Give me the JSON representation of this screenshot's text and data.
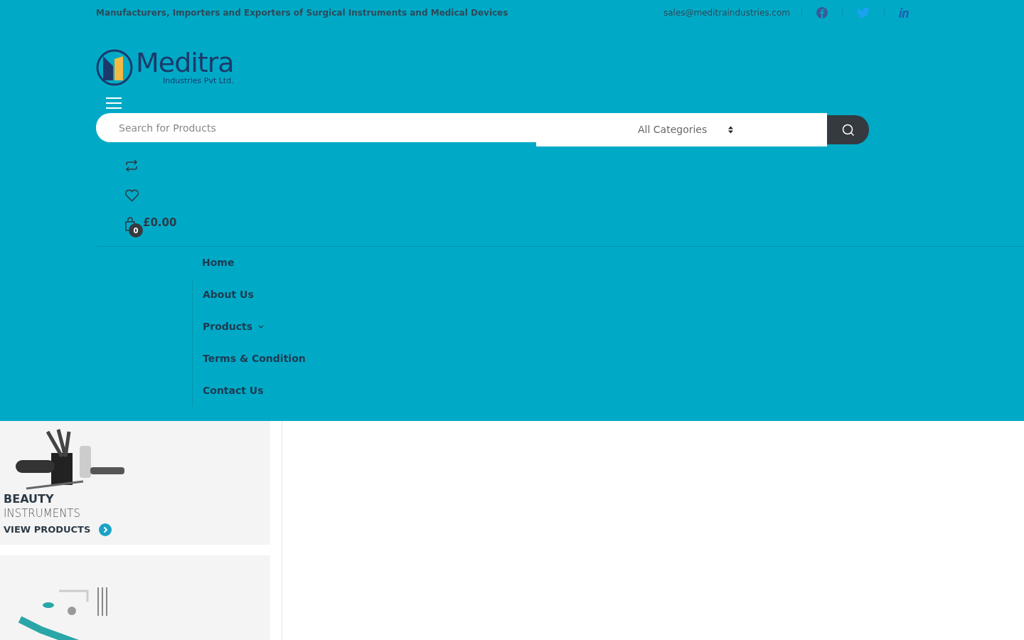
{
  "top_bar": {
    "tagline": "Manufacturers, Importers and Exporters of Surgical Instruments and Medical Devices",
    "email": "sales@meditraindustries.com",
    "social": [
      {
        "kind": "facebook"
      },
      {
        "kind": "twitter"
      },
      {
        "kind": "linkedin"
      }
    ]
  },
  "logo": {
    "name": "Meditra",
    "subtitle": "Industries Pvt Ltd."
  },
  "search": {
    "placeholder": "Search for Products",
    "category": "All Categories"
  },
  "header_actions": {
    "cart_total": "£0.00",
    "cart_count": "0"
  },
  "nav": [
    {
      "label": "Home",
      "has_dropdown": false
    },
    {
      "label": "About Us",
      "has_dropdown": false
    },
    {
      "label": "Products",
      "has_dropdown": true
    },
    {
      "label": "Terms & Condition",
      "has_dropdown": false
    },
    {
      "label": "Contact Us",
      "has_dropdown": false
    }
  ],
  "product_cards": [
    {
      "kind": "beauty",
      "title": "BEAUTY",
      "subtitle": "INSTRUMENTS",
      "link": "VIEW PRODUCTS"
    },
    {
      "kind": "dental"
    }
  ]
}
